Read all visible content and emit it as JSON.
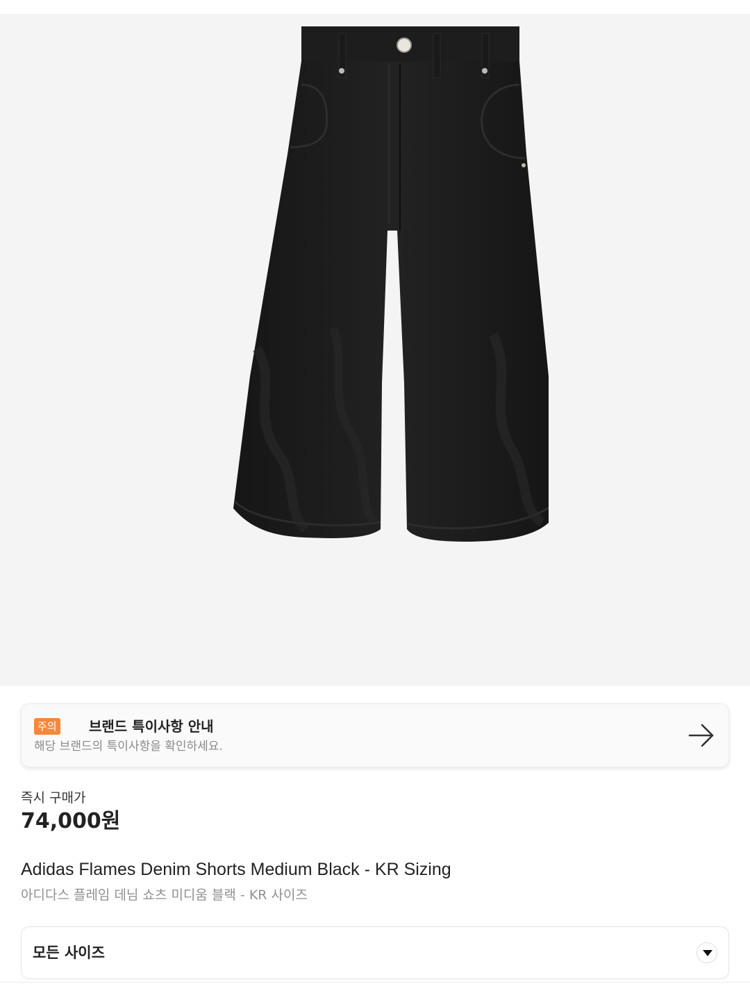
{
  "product_image": {
    "alt": "Adidas Flames Denim Shorts Medium Black",
    "background_color": "#f4f4f4",
    "product_color": "#1b1b1b"
  },
  "notice": {
    "badge": "주의",
    "title": "브랜드 특이사항 안내",
    "subtitle": "해당 브랜드의 특이사항을 확인하세요.",
    "arrow_icon": "arrow-right-icon",
    "badge_color": "#f6883a"
  },
  "price": {
    "label": "즉시 구매가",
    "value": "74,000원"
  },
  "product": {
    "name_en": "Adidas Flames Denim Shorts Medium Black - KR Sizing",
    "name_ko": "아디다스 플레임 데님 쇼츠 미디움 블랙 - KR 사이즈"
  },
  "size_selector": {
    "label": "모든 사이즈",
    "icon": "caret-down-icon"
  }
}
